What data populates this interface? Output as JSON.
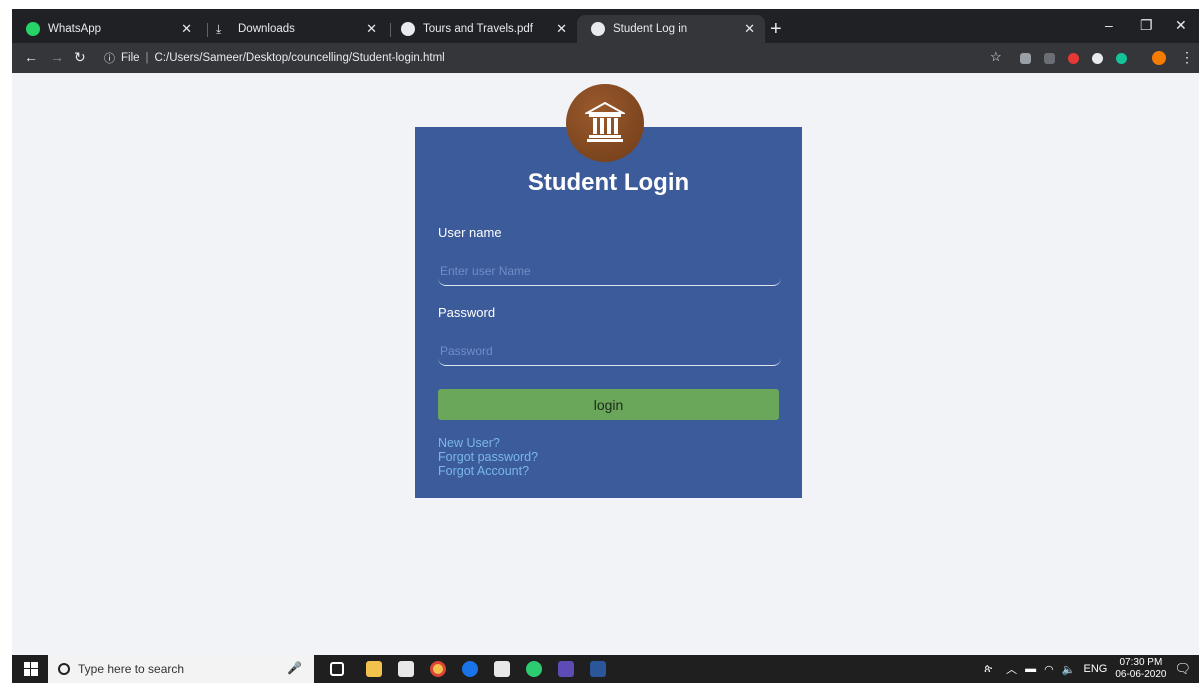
{
  "browser": {
    "tabs": [
      {
        "title": "WhatsApp",
        "icon": "whatsapp-icon",
        "color": "#25d366"
      },
      {
        "title": "Downloads",
        "icon": "download-icon",
        "color": "#e8eaed"
      },
      {
        "title": "Tours and Travels.pdf",
        "icon": "globe-icon",
        "color": "#e8eaed"
      },
      {
        "title": "Student Log in",
        "icon": "globe-icon",
        "color": "#e8eaed"
      }
    ],
    "address": {
      "scheme_label": "File",
      "url": "C:/Users/Sameer/Desktop/councelling/Student-login.html"
    }
  },
  "login": {
    "title": "Student Login",
    "username_label": "User name",
    "username_placeholder": "Enter user Name",
    "password_label": "Password",
    "password_placeholder": "Password",
    "button_label": "login",
    "links": [
      "New User?",
      "Forgot password?",
      "Forgot Account?"
    ]
  },
  "taskbar": {
    "search_placeholder": "Type here to search",
    "language": "ENG",
    "time": "07:30 PM",
    "date": "06-06-2020"
  },
  "colors": {
    "card": "#3c5b9a",
    "button": "#6ba75a",
    "link": "#79b8e8",
    "logo": "#7a4320"
  }
}
